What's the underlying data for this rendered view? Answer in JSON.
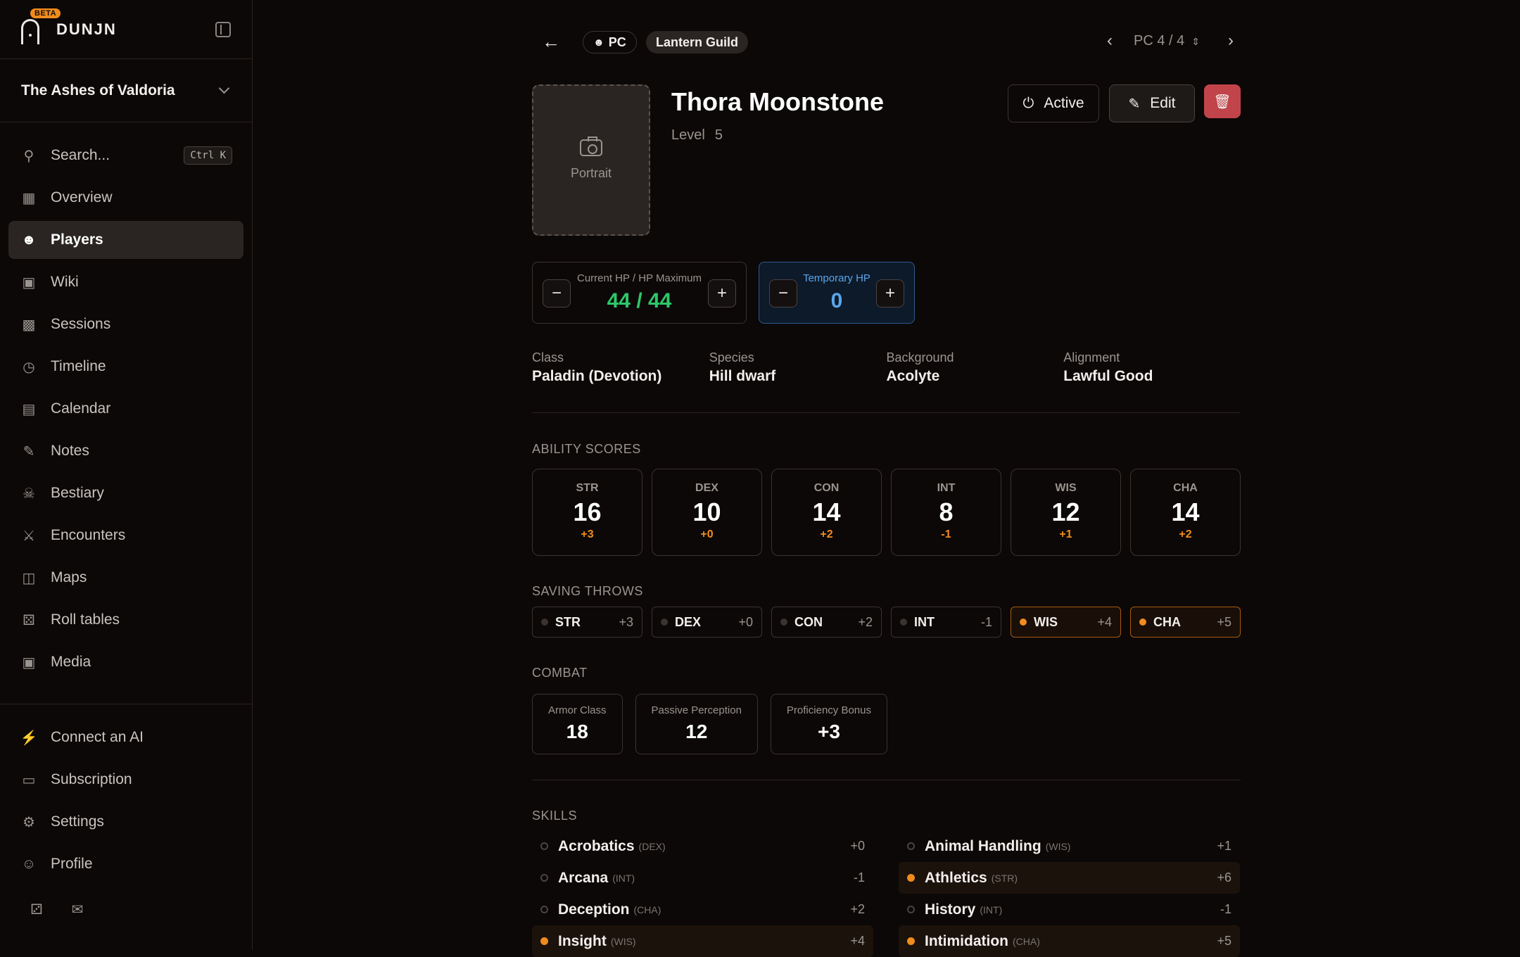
{
  "brand": {
    "name": "DUNJN",
    "badge": "BETA"
  },
  "campaign": {
    "name": "The Ashes of Valdoria"
  },
  "search": {
    "label": "Search...",
    "shortcut": "Ctrl K"
  },
  "nav": [
    {
      "label": "Overview",
      "icon": "grid-icon"
    },
    {
      "label": "Players",
      "icon": "users-icon",
      "active": true
    },
    {
      "label": "Wiki",
      "icon": "book-icon"
    },
    {
      "label": "Sessions",
      "icon": "calendar-grid-icon"
    },
    {
      "label": "Timeline",
      "icon": "clock-icon"
    },
    {
      "label": "Calendar",
      "icon": "calendar-icon"
    },
    {
      "label": "Notes",
      "icon": "note-icon"
    },
    {
      "label": "Bestiary",
      "icon": "skull-icon"
    },
    {
      "label": "Encounters",
      "icon": "swords-icon"
    },
    {
      "label": "Maps",
      "icon": "map-icon"
    },
    {
      "label": "Roll tables",
      "icon": "dice-icon"
    },
    {
      "label": "Media",
      "icon": "image-icon"
    }
  ],
  "nav_bottom": [
    {
      "label": "Connect an AI",
      "icon": "plug-icon"
    },
    {
      "label": "Subscription",
      "icon": "card-icon"
    },
    {
      "label": "Settings",
      "icon": "gear-icon"
    },
    {
      "label": "Profile",
      "icon": "profile-icon"
    }
  ],
  "topbar": {
    "type_pill": "PC",
    "group_pill": "Lantern Guild",
    "pager": "PC 4 / 4"
  },
  "character": {
    "name": "Thora Moonstone",
    "level_label": "Level",
    "level": "5",
    "portrait_label": "Portrait",
    "active_label": "Active",
    "edit_label": "Edit"
  },
  "hp": {
    "label": "Current HP / HP Maximum",
    "value": "44 / 44",
    "temp_label": "Temporary HP",
    "temp_value": "0"
  },
  "info": [
    {
      "label": "Class",
      "value": "Paladin (Devotion)"
    },
    {
      "label": "Species",
      "value": "Hill dwarf"
    },
    {
      "label": "Background",
      "value": "Acolyte"
    },
    {
      "label": "Alignment",
      "value": "Lawful Good"
    }
  ],
  "sections": {
    "abilities": "ABILITY SCORES",
    "saves": "SAVING THROWS",
    "combat": "COMBAT",
    "skills": "SKILLS"
  },
  "abilities": [
    {
      "name": "STR",
      "score": "16",
      "mod": "+3"
    },
    {
      "name": "DEX",
      "score": "10",
      "mod": "+0"
    },
    {
      "name": "CON",
      "score": "14",
      "mod": "+2"
    },
    {
      "name": "INT",
      "score": "8",
      "mod": "-1"
    },
    {
      "name": "WIS",
      "score": "12",
      "mod": "+1"
    },
    {
      "name": "CHA",
      "score": "14",
      "mod": "+2"
    }
  ],
  "saves": [
    {
      "name": "STR",
      "mod": "+3",
      "proficient": false
    },
    {
      "name": "DEX",
      "mod": "+0",
      "proficient": false
    },
    {
      "name": "CON",
      "mod": "+2",
      "proficient": false
    },
    {
      "name": "INT",
      "mod": "-1",
      "proficient": false
    },
    {
      "name": "WIS",
      "mod": "+4",
      "proficient": true
    },
    {
      "name": "CHA",
      "mod": "+5",
      "proficient": true
    }
  ],
  "combat": [
    {
      "label": "Armor Class",
      "value": "18"
    },
    {
      "label": "Passive Perception",
      "value": "12"
    },
    {
      "label": "Proficiency Bonus",
      "value": "+3"
    }
  ],
  "skills_left": [
    {
      "name": "Acrobatics",
      "attr": "(DEX)",
      "mod": "+0",
      "proficient": false
    },
    {
      "name": "Arcana",
      "attr": "(INT)",
      "mod": "-1",
      "proficient": false
    },
    {
      "name": "Deception",
      "attr": "(CHA)",
      "mod": "+2",
      "proficient": false
    },
    {
      "name": "Insight",
      "attr": "(WIS)",
      "mod": "+4",
      "proficient": true
    }
  ],
  "skills_right": [
    {
      "name": "Animal Handling",
      "attr": "(WIS)",
      "mod": "+1",
      "proficient": false
    },
    {
      "name": "Athletics",
      "attr": "(STR)",
      "mod": "+6",
      "proficient": true
    },
    {
      "name": "History",
      "attr": "(INT)",
      "mod": "-1",
      "proficient": false
    },
    {
      "name": "Intimidation",
      "attr": "(CHA)",
      "mod": "+5",
      "proficient": true
    }
  ],
  "colors": {
    "accent": "#f08c1e",
    "hp": "#2ec76a",
    "temp_hp": "#5aa6ea",
    "danger": "#c1444a"
  }
}
